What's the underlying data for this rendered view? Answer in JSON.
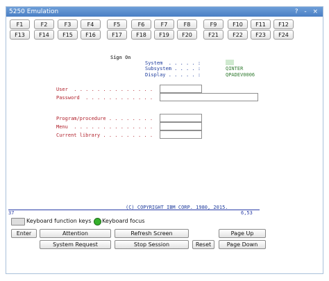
{
  "window": {
    "title": "5250 Emulation",
    "controls": "? - ×"
  },
  "fkeys_row1": [
    "F1",
    "F2",
    "F3",
    "F4",
    "F5",
    "F6",
    "F7",
    "F8",
    "F9",
    "F10",
    "F11",
    "F12"
  ],
  "fkeys_row2": [
    "F13",
    "F14",
    "F15",
    "F16",
    "F17",
    "F18",
    "F19",
    "F20",
    "F21",
    "F22",
    "F23",
    "F24"
  ],
  "screen": {
    "heading": "Sign On",
    "system_label": "System  . . . . . :",
    "subsystem_label": "Subsystem . . . . :",
    "display_label": "Display . . . . . :",
    "system_value": "",
    "subsystem_value": "QINTER",
    "display_value": "QPADEV0006",
    "user_label": "User  . . . . . . . . . . . . . .",
    "password_label": "Password  . . . . . . . . . . . .",
    "program_label": "Program/procedure . . . . . . . .",
    "menu_label": "Menu  . . . . . . . . . . . . . .",
    "library_label": "Current library . . . . . . . . .",
    "copyright": "(C) COPYRIGHT IBM CORP. 1980, 2015."
  },
  "status": {
    "left": "37",
    "right": "6,53"
  },
  "options": {
    "keyboard_keys": "Keyboard function keys",
    "keyboard_focus": "Keyboard focus"
  },
  "buttons": {
    "enter": "Enter",
    "attention": "Attention",
    "refresh": "Refresh Screen",
    "page_up": "Page Up",
    "system_request": "System Request",
    "stop_session": "Stop Session",
    "reset": "Reset",
    "page_down": "Page Down"
  },
  "colors": {
    "title_bar": "#4a7fc4",
    "status_line": "#2a3da8",
    "focus_indicator": "#35b02c"
  }
}
